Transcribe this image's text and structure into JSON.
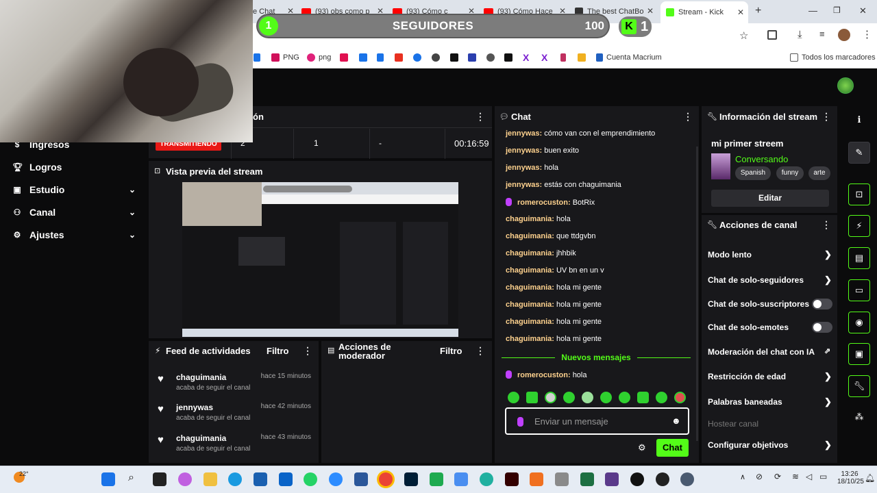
{
  "browser": {
    "tabs": [
      {
        "title": "e Chat"
      },
      {
        "title": "(93) obs como p"
      },
      {
        "title": "(93) Cómo c"
      },
      {
        "title": "(93) Cómo Hace"
      },
      {
        "title": "The best ChatBo"
      },
      {
        "title": "Stream - Kick"
      }
    ],
    "bookmarks": [
      "PNG",
      "png",
      "Cuenta Macrium",
      "Todos los marcadores"
    ]
  },
  "goal_overlay": {
    "current": "1",
    "label": "SEGUIDORES",
    "target": "100",
    "kick_count": "1"
  },
  "sidebar": {
    "items": [
      {
        "label": "Ingresos",
        "icon": "money-icon"
      },
      {
        "label": "Logros",
        "icon": "trophy-icon"
      },
      {
        "label": "Estudio",
        "icon": "camera-icon"
      },
      {
        "label": "Canal",
        "icon": "users-icon"
      },
      {
        "label": "Ajustes",
        "icon": "gear-icon"
      }
    ]
  },
  "session": {
    "title_fragment": "ón",
    "status": "TRANSMITIENDO",
    "viewers": "2",
    "followers": "1",
    "subs": "-",
    "duration": "00:16:59"
  },
  "preview": {
    "title": "Vista previa del stream"
  },
  "activity": {
    "title": "Feed de actividades",
    "filter": "Filtro",
    "items": [
      {
        "user": "chaguimania",
        "time": "hace 15 minutos",
        "action": "acaba de seguir el canal"
      },
      {
        "user": "jennywas",
        "time": "hace 42 minutos",
        "action": "acaba de seguir el canal"
      },
      {
        "user": "chaguimania",
        "time": "hace 43 minutos",
        "action": "acaba de seguir el canal"
      }
    ]
  },
  "mod_actions": {
    "title": "Acciones de moderador",
    "filter": "Filtro"
  },
  "chat": {
    "title": "Chat",
    "messages": [
      {
        "user": "jennywas:",
        "text": "cómo van con el emprendimiento"
      },
      {
        "user": "jennywas:",
        "text": "buen exito"
      },
      {
        "user": "jennywas:",
        "text": "hola"
      },
      {
        "user": "jennywas:",
        "text": "estás con chaguimania"
      },
      {
        "user": "romerocuston:",
        "text": "BotRix"
      },
      {
        "user": "chaguimania:",
        "text": "hola"
      },
      {
        "user": "chaguimania:",
        "text": "que ttdgvbn"
      },
      {
        "user": "chaguimania:",
        "text": "jhhbik"
      },
      {
        "user": "chaguimania:",
        "text": "UV bn en un v"
      },
      {
        "user": "chaguimania:",
        "text": "hola mi gente"
      },
      {
        "user": "chaguimania:",
        "text": "hola mi gente"
      },
      {
        "user": "chaguimania:",
        "text": "hola mi gente"
      },
      {
        "user": "chaguimania:",
        "text": "hola mi gente"
      }
    ],
    "new_messages": "Nuevos mensajes",
    "last_message": {
      "user": "romerocuston:",
      "text": "hola"
    },
    "placeholder": "Enviar un mensaje",
    "send": "Chat"
  },
  "stream_info": {
    "title": "Información del stream",
    "stream_title": "mi primer streem",
    "category": "Conversando",
    "tags": [
      "Spanish",
      "funny",
      "arte"
    ],
    "edit": "Editar"
  },
  "channel_actions": {
    "title": "Acciones de canal",
    "items": [
      {
        "label": "Modo lento"
      },
      {
        "label": "Chat de solo-seguidores"
      },
      {
        "label": "Chat de solo-suscriptores"
      },
      {
        "label": "Chat de solo-emotes"
      },
      {
        "label": "Moderación del chat con IA"
      },
      {
        "label": "Restricción de edad"
      },
      {
        "label": "Palabras baneadas"
      },
      {
        "label": "Hostear canal"
      },
      {
        "label": "Configurar objetivos"
      }
    ]
  },
  "taskbar": {
    "weather": "22°",
    "time": "13:26",
    "date": "18/10/25"
  },
  "colors": {
    "accent": "#53fc18",
    "live": "#e91916",
    "panel": "#18181b",
    "bg": "#0b0b0c"
  }
}
